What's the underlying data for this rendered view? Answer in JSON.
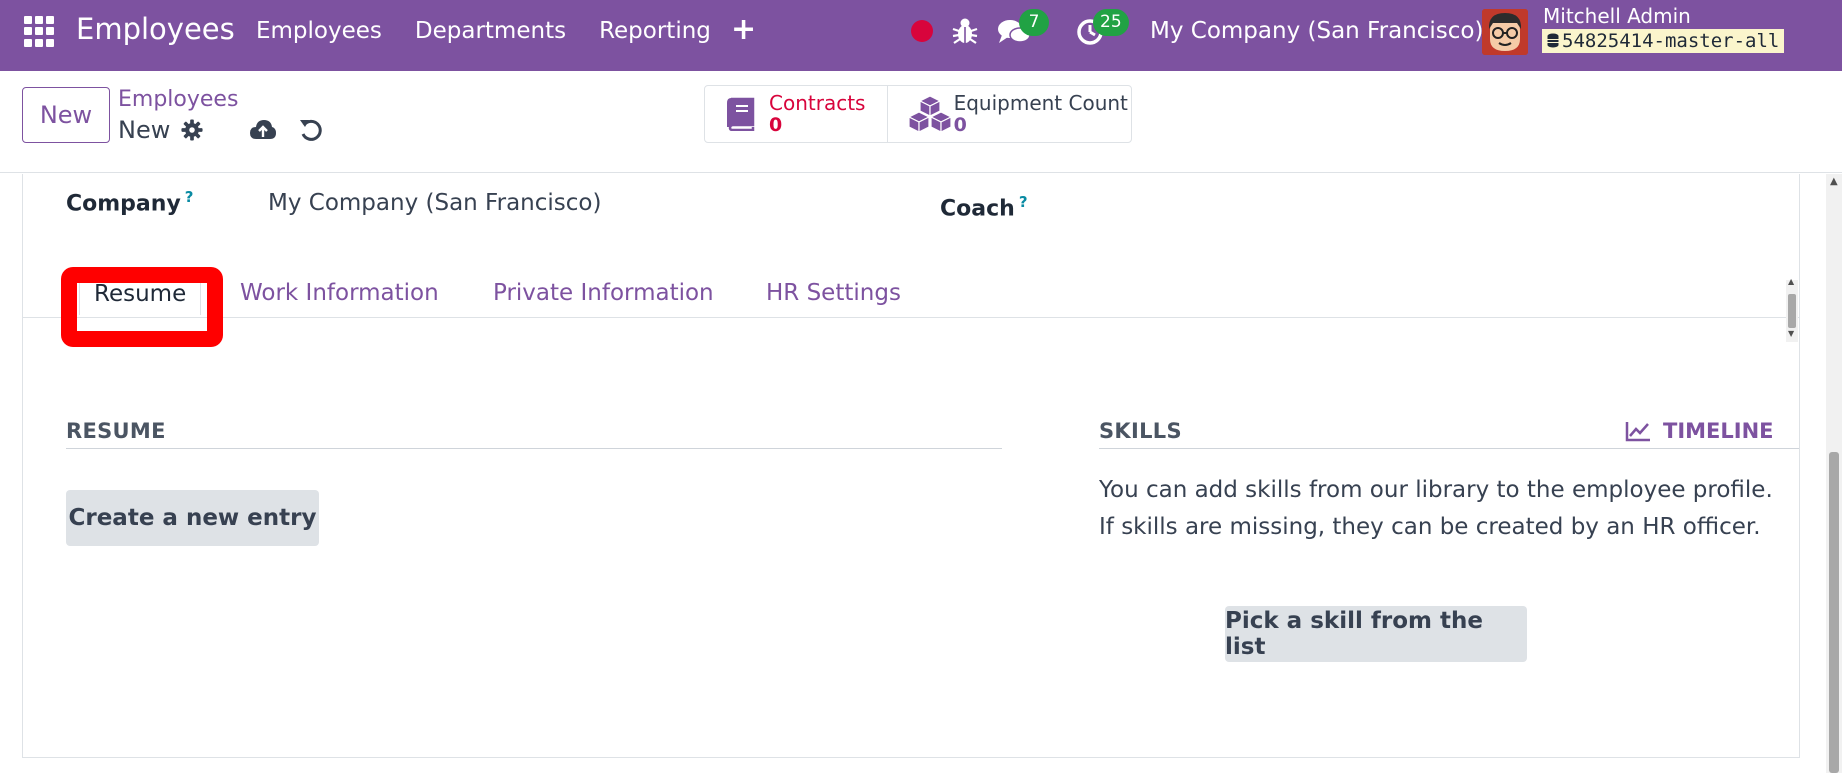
{
  "navbar": {
    "app_name": "Employees",
    "menu": [
      "Employees",
      "Departments",
      "Reporting"
    ],
    "messages_count": "7",
    "activities_count": "25",
    "company": "My Company (San Francisco)",
    "user_name": "Mitchell Admin",
    "database": "54825414-master-all",
    "colors": {
      "brand": "#7d52a0",
      "badge": "#21a244",
      "record": "#d8043c"
    }
  },
  "control_panel": {
    "new_button": "New",
    "breadcrumb_parent": "Employees",
    "breadcrumb_current": "New",
    "smart_buttons": [
      {
        "label": "Contracts",
        "value": "0",
        "icon": "book-icon"
      },
      {
        "label": "Equipment Count",
        "value": "0",
        "icon": "cubes-icon"
      }
    ]
  },
  "form": {
    "company_label": "Company",
    "company_value": "My Company (San Francisco)",
    "coach_label": "Coach",
    "help_mark": "?",
    "tabs": [
      "Resume",
      "Work Information",
      "Private Information",
      "HR Settings"
    ],
    "resume": {
      "title": "RESUME",
      "create_button": "Create a new entry"
    },
    "skills": {
      "title": "SKILLS",
      "timeline_link": "TIMELINE",
      "help_line1": "You can add skills from our library to the employee profile.",
      "help_line2": "If skills are missing, they can be created by an HR officer.",
      "pick_button": "Pick a skill from the list"
    }
  }
}
